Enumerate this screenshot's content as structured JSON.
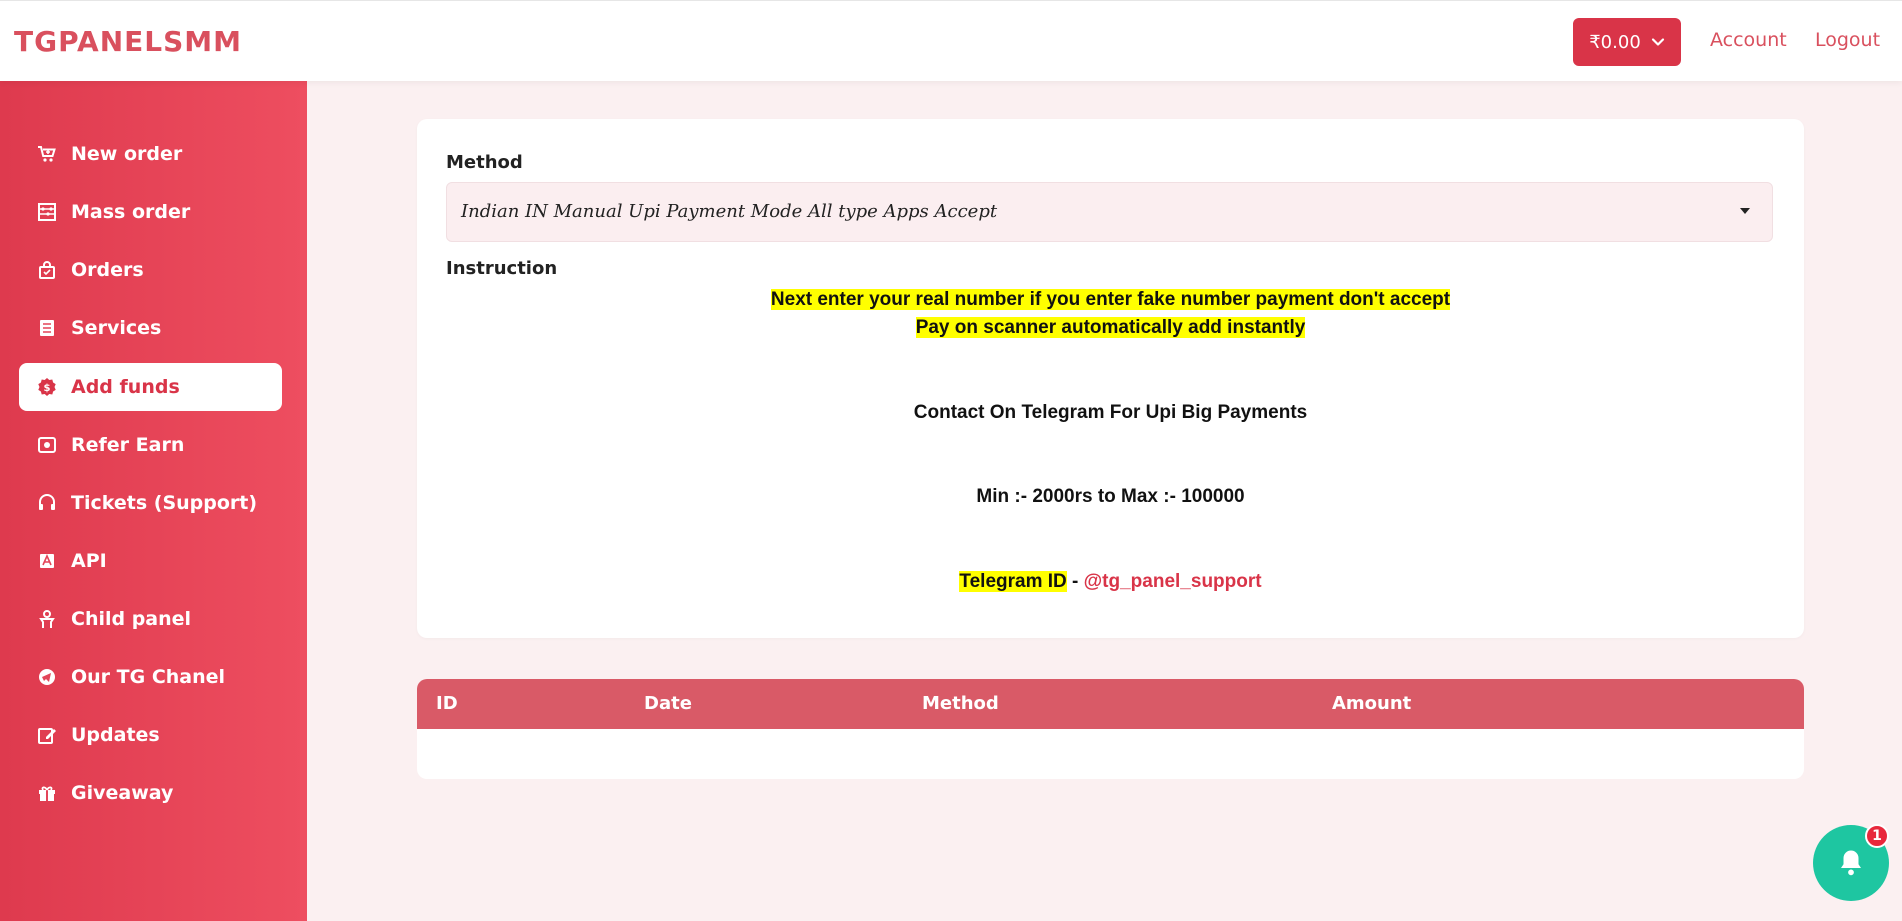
{
  "header": {
    "brand": "TGPANELSMM",
    "balance": "₹0.00",
    "account_label": "Account",
    "logout_label": "Logout"
  },
  "sidebar": {
    "items": [
      {
        "label": "New order",
        "icon": "cart-icon"
      },
      {
        "label": "Mass order",
        "icon": "abacus-icon"
      },
      {
        "label": "Orders",
        "icon": "shopping-bag-icon"
      },
      {
        "label": "Services",
        "icon": "list-icon"
      },
      {
        "label": "Add funds",
        "icon": "dollar-icon",
        "active": true
      },
      {
        "label": "Refer Earn",
        "icon": "money-icon"
      },
      {
        "label": "Tickets (Support)",
        "icon": "headset-icon"
      },
      {
        "label": "API",
        "icon": "api-icon"
      },
      {
        "label": "Child panel",
        "icon": "child-icon"
      },
      {
        "label": "Our TG Chanel",
        "icon": "telegram-icon"
      },
      {
        "label": "Updates",
        "icon": "edit-icon"
      },
      {
        "label": "Giveaway",
        "icon": "gift-icon"
      }
    ]
  },
  "form": {
    "method_label": "Method",
    "method_value": "Indian IN Manual Upi Payment Mode All type Apps Accept",
    "instruction_label": "Instruction",
    "instruction_line1": "Next enter your real number if you enter fake number payment don't accept ",
    "instruction_line2": "Pay on scanner automatically add instantly ",
    "contact_line": "Contact On Telegram For Upi Big Payments",
    "limits_line": "Min :- 2000rs to Max :- 100000",
    "telegram_label": "Telegram ID",
    "telegram_sep": " - ",
    "telegram_handle": "@tg_panel_support"
  },
  "table": {
    "headers": [
      "ID",
      "Date",
      "Method",
      "Amount"
    ],
    "rows": []
  },
  "notifications": {
    "count": "1"
  },
  "colors": {
    "accent": "#d93448",
    "sidebar_start": "#de3a4e",
    "sidebar_end": "#ee4e60",
    "table_header": "#d95a67",
    "highlight": "#ffff00",
    "bell": "#1ec6a1"
  }
}
